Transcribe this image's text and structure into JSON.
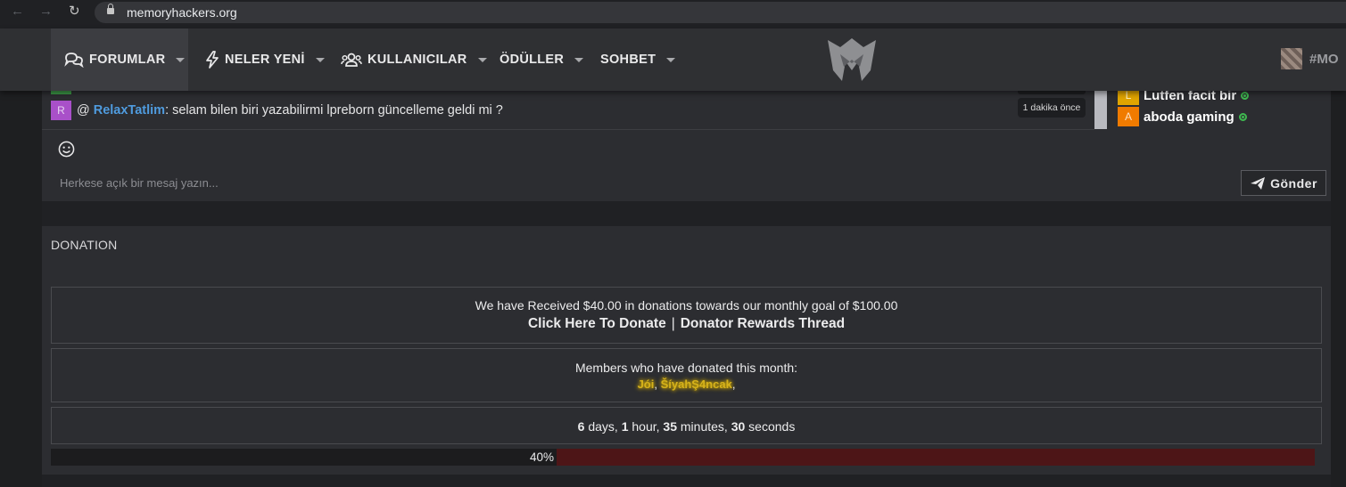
{
  "browser": {
    "url": "memoryhackers.org",
    "icons": [
      "back-arrow-icon",
      "forward-arrow-icon",
      "reload-icon",
      "lock-icon"
    ]
  },
  "nav": {
    "items": [
      {
        "label": "FORUMLAR",
        "icon": "chat-bubbles-icon"
      },
      {
        "label": "NELER YENİ",
        "icon": "lightning-icon"
      },
      {
        "label": "KULLANICILAR",
        "icon": "users-icon"
      },
      {
        "label": "ÖDÜLLER"
      },
      {
        "label": "SOHBET"
      }
    ],
    "hashtag": "#MO"
  },
  "chat": {
    "message": {
      "avatar_letter": "R",
      "at": "@",
      "author": "RelaxTatlim",
      "text": ": selam bilen biri yazabilirmi lpreborn güncelleme geldi mi ?",
      "time": "1 dakika önce"
    },
    "online_users": [
      {
        "avatar_letter": "L",
        "name": "Lutfen facit bir",
        "avatar_color": "#e0a400"
      },
      {
        "avatar_letter": "A",
        "name": "aboda gaming",
        "avatar_color": "#f07b00"
      }
    ],
    "input_placeholder": "Herkese açık bir mesaj yazın...",
    "send_label": "Gönder"
  },
  "donation": {
    "title": "DONATION",
    "goal_text": "We have Received $40.00 in donations towards our monthly goal of $100.00",
    "donate_link": "Click Here To Donate",
    "separator": "|",
    "rewards_link": "Donator Rewards Thread",
    "members_label": "Members who have donated this month:",
    "donors": [
      "Jói",
      "ŠíyahŞ4ncak"
    ],
    "timer": {
      "days": "6",
      "days_label": "days,",
      "hours": "1",
      "hours_label": "hour,",
      "minutes": "35",
      "minutes_label": "minutes,",
      "seconds": "30",
      "seconds_label": "seconds"
    },
    "progress_label": "40%",
    "progress_value": 0.4
  }
}
